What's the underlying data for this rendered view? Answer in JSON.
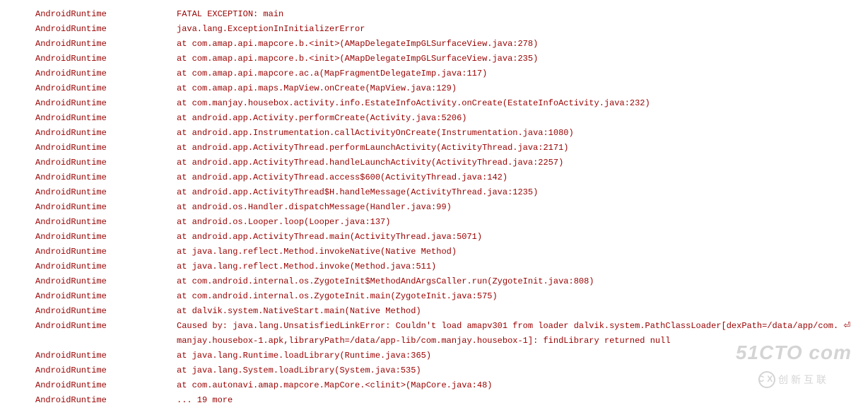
{
  "log": {
    "tag": "AndroidRuntime",
    "lines": [
      "FATAL EXCEPTION: main",
      "java.lang.ExceptionInInitializerError",
      "at com.amap.api.mapcore.b.<init>(AMapDelegateImpGLSurfaceView.java:278)",
      "at com.amap.api.mapcore.b.<init>(AMapDelegateImpGLSurfaceView.java:235)",
      "at com.amap.api.mapcore.ac.a(MapFragmentDelegateImp.java:117)",
      "at com.amap.api.maps.MapView.onCreate(MapView.java:129)",
      "at com.manjay.housebox.activity.info.EstateInfoActivity.onCreate(EstateInfoActivity.java:232)",
      "at android.app.Activity.performCreate(Activity.java:5206)",
      "at android.app.Instrumentation.callActivityOnCreate(Instrumentation.java:1080)",
      "at android.app.ActivityThread.performLaunchActivity(ActivityThread.java:2171)",
      "at android.app.ActivityThread.handleLaunchActivity(ActivityThread.java:2257)",
      "at android.app.ActivityThread.access$600(ActivityThread.java:142)",
      "at android.app.ActivityThread$H.handleMessage(ActivityThread.java:1235)",
      "at android.os.Handler.dispatchMessage(Handler.java:99)",
      "at android.os.Looper.loop(Looper.java:137)",
      "at android.app.ActivityThread.main(ActivityThread.java:5071)",
      "at java.lang.reflect.Method.invokeNative(Native Method)",
      "at java.lang.reflect.Method.invoke(Method.java:511)",
      "at com.android.internal.os.ZygoteInit$MethodAndArgsCaller.run(ZygoteInit.java:808)",
      "at com.android.internal.os.ZygoteInit.main(ZygoteInit.java:575)",
      "at dalvik.system.NativeStart.main(Native Method)",
      "Caused by: java.lang.UnsatisfiedLinkError: Couldn't load amapv301 from loader dalvik.system.PathClassLoader[dexPath=/data/app/com. ⏎",
      "manjay.housebox-1.apk,libraryPath=/data/app-lib/com.manjay.housebox-1]: findLibrary returned null",
      "at java.lang.Runtime.loadLibrary(Runtime.java:365)",
      "at java.lang.System.loadLibrary(System.java:535)",
      "at com.autonavi.amap.mapcore.MapCore.<clinit>(MapCore.java:48)",
      "... 19 more"
    ],
    "continuation_indices": [
      22
    ]
  },
  "watermark": {
    "top": "51CTO com",
    "bottom": "创新互联",
    "logo": "CX"
  }
}
